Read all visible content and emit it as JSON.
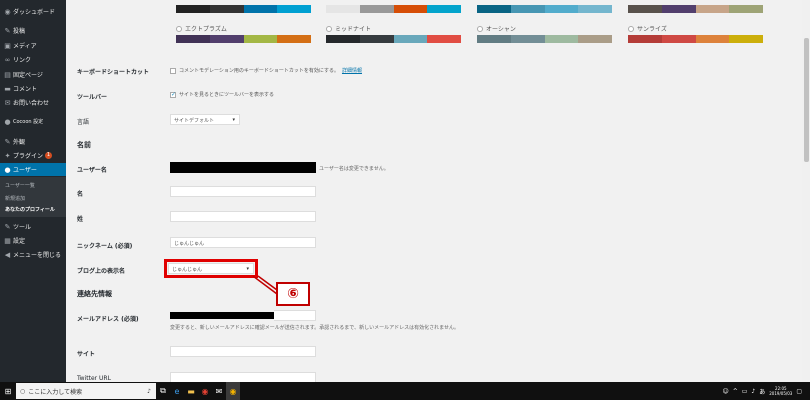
{
  "sidebar": {
    "items": [
      {
        "label": "ダッシュボード",
        "icon": "dashboard-icon",
        "glyph": "◉"
      },
      {
        "label": "投稿",
        "icon": "pin-icon",
        "glyph": "✎"
      },
      {
        "label": "メディア",
        "icon": "media-icon",
        "glyph": "▣"
      },
      {
        "label": "リンク",
        "icon": "link-icon",
        "glyph": "∞"
      },
      {
        "label": "固定ページ",
        "icon": "page-icon",
        "glyph": "▤"
      },
      {
        "label": "コメント",
        "icon": "comment-icon",
        "glyph": "▬"
      },
      {
        "label": "お問い合わせ",
        "icon": "mail-icon",
        "glyph": "✉"
      },
      {
        "label": "Cocoon 設定",
        "icon": "cocoon-icon",
        "glyph": "●"
      },
      {
        "label": "外観",
        "icon": "appearance-icon",
        "glyph": "✎"
      },
      {
        "label": "プラグイン",
        "icon": "plugin-icon",
        "glyph": "✦",
        "badge": "1"
      },
      {
        "label": "ユーザー",
        "icon": "user-icon",
        "glyph": "👤"
      },
      {
        "label": "ツール",
        "icon": "tools-icon",
        "glyph": "✎"
      },
      {
        "label": "設定",
        "icon": "settings-icon",
        "glyph": "▦"
      },
      {
        "label": "メニューを閉じる",
        "icon": "collapse-icon",
        "glyph": "◀"
      }
    ],
    "submenu": [
      "ユーザー一覧",
      "新規追加",
      "あなたのプロフィール"
    ]
  },
  "schemes": [
    {
      "name": "エクトプラズム",
      "colors": [
        "#413256",
        "#523f6d",
        "#a3b745",
        "#d46f15"
      ]
    },
    {
      "name": "ミッドナイト",
      "colors": [
        "#25282b",
        "#363b3f",
        "#69a8bb",
        "#e14d43"
      ]
    },
    {
      "name": "オーシャン",
      "colors": [
        "#627c83",
        "#738e96",
        "#9ebaa0",
        "#aa9d88"
      ]
    },
    {
      "name": "サンライズ",
      "colors": [
        "#b43c38",
        "#cf4944",
        "#dd823b",
        "#ccaf0b"
      ]
    }
  ],
  "top_schemes": [
    [
      "#222",
      "#333",
      "#0073aa",
      "#00a0d2"
    ],
    [
      "#e5e5e5",
      "#999",
      "#d64e07",
      "#04a4cc"
    ],
    [
      "#096484",
      "#4796b3",
      "#52accc",
      "#74b6ce"
    ],
    [
      "#59524c",
      "#523f6d",
      "#c7a589",
      "#9ea476"
    ]
  ],
  "form": {
    "keyboard_label": "キーボードショートカット",
    "keyboard_text": "コメントモデレーション用のキーボードショートカットを有効にする。",
    "keyboard_link": "詳細情報",
    "toolbar_label": "ツールバー",
    "toolbar_text": "サイトを見るときにツールバーを表示する",
    "language_label": "言語",
    "language_value": "サイトデフォルト",
    "name_section": "名前",
    "username_label": "ユーザー名",
    "username_note": "ユーザー名は変更できません。",
    "firstname_label": "名",
    "lastname_label": "姓",
    "nickname_label": "ニックネーム (必須)",
    "nickname_value": "じゅんじゅん",
    "display_label": "ブログ上の表示名",
    "display_value": "じゅんじゅん",
    "contact_section": "連絡先情報",
    "email_label": "メールアドレス (必須)",
    "email_note": "変更すると、新しいメールアドレスに確認メールが送信されます。承認されるまで、新しいメールアドレスは有効化されません。",
    "site_label": "サイト",
    "twitter_label": "Twitter URL"
  },
  "callout": {
    "number": "⑥"
  },
  "taskbar": {
    "search_placeholder": "ここに入力して検索",
    "time": "22:05",
    "date": "2019/05/03"
  }
}
